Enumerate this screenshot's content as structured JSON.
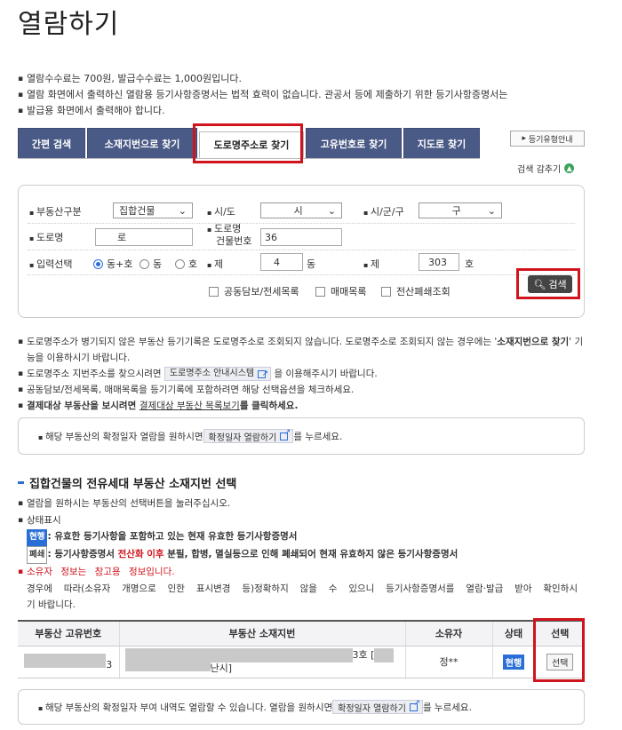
{
  "page_title": "열람하기",
  "notes": [
    "열람수수료는 700원, 발급수수료는 1,000원입니다.",
    "열람 화면에서 출력하신 열람용 등기사항증명서는 법적 효력이 없습니다. 관공서 등에 제출하기 위한 등기사항증명서는",
    "발급용 화면에서 출력해야 합니다."
  ],
  "tabs": [
    {
      "label": "간편 검색"
    },
    {
      "label": "소재지번으로 찾기"
    },
    {
      "label": "도로명주소로 찾기"
    },
    {
      "label": "고유번호로 찾기"
    },
    {
      "label": "지도로 찾기"
    }
  ],
  "guide_button": "등기유형안내",
  "collapse_label": "검색 감추기",
  "search": {
    "property_type_label": "부동산구분",
    "property_type_value": "집합건물",
    "sido_label": "시/도",
    "sido_value": "시",
    "sigungu_label": "시/군/구",
    "sigungu_value": "구",
    "road_label": "도로명",
    "road_value": "로",
    "building_no_label_1": "도로명",
    "building_no_label_2": "건물번호",
    "building_no_value": "36",
    "input_select_label": "입력선택",
    "radio_options": [
      "동+호",
      "동",
      "호"
    ],
    "dong_prefix": "제",
    "dong_value": "4",
    "dong_suffix": "동",
    "ho_prefix": "제",
    "ho_value": "303",
    "ho_suffix": "호",
    "checkboxes": [
      "공동담보/전세목록",
      "매매목록",
      "전산폐쇄조회"
    ],
    "search_button": "검색"
  },
  "info": {
    "line1a": "도로명주소가 병기되지 않은 부동산 등기기록은 도로명주소로 조회되지 않습니다. 도로명주소로 조회되지 않는 경우에는 '",
    "line1b": "소재지번으로 찾기",
    "line1c": "' 기능을 이용하시기 바랍니다.",
    "line2a": "도로명주소 지번주소를 찾으시려면 ",
    "line2_btn": "도로명주소 안내시스템",
    "line2b": " 을 이용해주시기 바랍니다.",
    "line3": "공동담보/전세목록, 매매목록을 등기기록에 포함하려면 해당 선택옵션을 체크하세요.",
    "line4a": "결제대상 부동산을 보시려면 ",
    "line4_link": "결제대상 부동산 목록보기",
    "line4b": "를 클릭하세요."
  },
  "confirm_box_1": {
    "text_a": "해당 부동산의 확정일자 열람을 원하시면 ",
    "button": "확정일자 열람하기",
    "text_b": " 를 누르세요."
  },
  "section_title": "집합건물의 전유세대 부동산 소재지번 선택",
  "legend": {
    "line1": "열람을 원하시는 부동산의 선택버튼을 눌러주십시오.",
    "line2": "상태표시",
    "badge_current": "현행",
    "current_desc": ": 유효한 등기사항을 포함하고 있는 현재 유효한 등기사항증명서",
    "badge_closed": "폐쇄",
    "closed_desc_a": ": 등기사항증명서 ",
    "closed_desc_red": "전산화 이후",
    "closed_desc_b": " 분필, 합병, 멸실등으로 인해 폐쇄되어 현재 유효하지 않은 등기사항증명서",
    "owner_line1": "소유자 정보는 참고용 정보입니다.",
    "owner_line2": "경우에 따라(소유자 개명으로 인한 표시변경 등)정확하지 않을 수 있으니 등기사항증명서를 열람·발급 받아 확인하시",
    "owner_line3": "기 바랍니다."
  },
  "table": {
    "headers": [
      "부동산 고유번호",
      "부동산 소재지번",
      "소유자",
      "상태",
      "선택"
    ],
    "rows": [
      {
        "id_tail": "3",
        "address_a": "3호 [",
        "address_b": "난시]",
        "owner": "정**",
        "state": "현행",
        "select": "선택"
      }
    ]
  },
  "confirm_box_2": {
    "text_a": "해당 부동산의 확정일자 부여 내역도 열람할 수 있습니다. 열람을 원하시면 ",
    "button": "확정일자 열람하기",
    "text_b": " 를 누르세요."
  },
  "colors": {
    "accent": "#2a6fd8",
    "tab_bg": "#4a5a86",
    "highlight": "#d0141d"
  }
}
